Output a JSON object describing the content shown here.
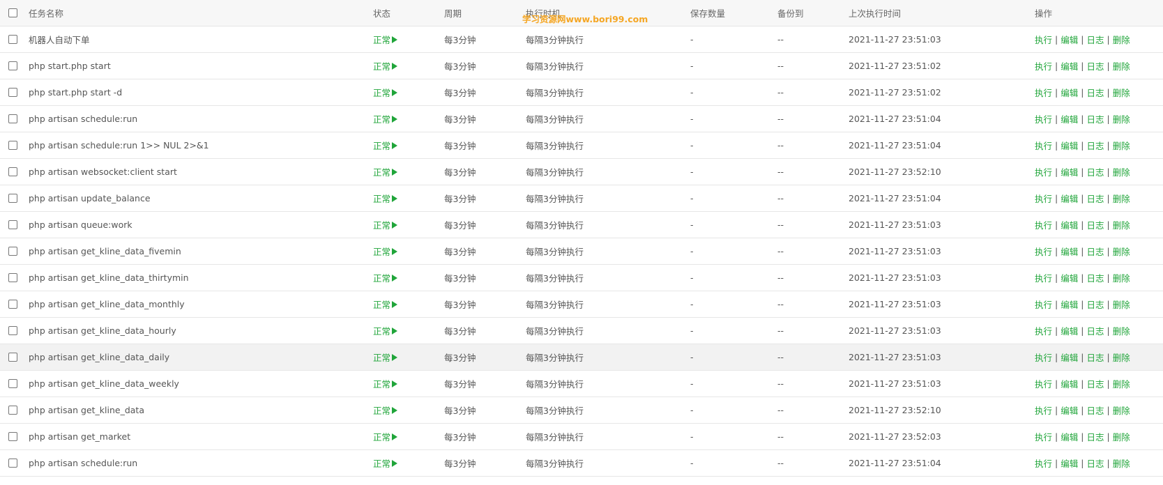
{
  "header": {
    "name": "任务名称",
    "status": "状态",
    "cycle": "周期",
    "exec_time": "执行时机",
    "save_count": "保存数量",
    "backup_to": "备份到",
    "last_run": "上次执行时间",
    "ops": "操作"
  },
  "watermark": "学习资源网www.bori99.com",
  "ops_labels": {
    "run": "执行",
    "edit": "编辑",
    "log": "日志",
    "delete": "删除",
    "sep": "|"
  },
  "colors": {
    "accent": "#20a53a",
    "watermark": "#f5a623"
  },
  "rows": [
    {
      "name": "机器人自动下单",
      "status": "正常",
      "cycle": "每3分钟",
      "exec": "每隔3分钟执行",
      "save": "-",
      "backup": "--",
      "last": "2021-11-27 23:51:03"
    },
    {
      "name": "php start.php start",
      "status": "正常",
      "cycle": "每3分钟",
      "exec": "每隔3分钟执行",
      "save": "-",
      "backup": "--",
      "last": "2021-11-27 23:51:02"
    },
    {
      "name": "php start.php start -d",
      "status": "正常",
      "cycle": "每3分钟",
      "exec": "每隔3分钟执行",
      "save": "-",
      "backup": "--",
      "last": "2021-11-27 23:51:02"
    },
    {
      "name": "php artisan schedule:run",
      "status": "正常",
      "cycle": "每3分钟",
      "exec": "每隔3分钟执行",
      "save": "-",
      "backup": "--",
      "last": "2021-11-27 23:51:04"
    },
    {
      "name": "php artisan schedule:run 1>> NUL 2>&1",
      "status": "正常",
      "cycle": "每3分钟",
      "exec": "每隔3分钟执行",
      "save": "-",
      "backup": "--",
      "last": "2021-11-27 23:51:04"
    },
    {
      "name": "php artisan websocket:client start",
      "status": "正常",
      "cycle": "每3分钟",
      "exec": "每隔3分钟执行",
      "save": "-",
      "backup": "--",
      "last": "2021-11-27 23:52:10"
    },
    {
      "name": "php artisan update_balance",
      "status": "正常",
      "cycle": "每3分钟",
      "exec": "每隔3分钟执行",
      "save": "-",
      "backup": "--",
      "last": "2021-11-27 23:51:04"
    },
    {
      "name": "php artisan queue:work",
      "status": "正常",
      "cycle": "每3分钟",
      "exec": "每隔3分钟执行",
      "save": "-",
      "backup": "--",
      "last": "2021-11-27 23:51:03"
    },
    {
      "name": "php artisan get_kline_data_fivemin",
      "status": "正常",
      "cycle": "每3分钟",
      "exec": "每隔3分钟执行",
      "save": "-",
      "backup": "--",
      "last": "2021-11-27 23:51:03"
    },
    {
      "name": "php artisan get_kline_data_thirtymin",
      "status": "正常",
      "cycle": "每3分钟",
      "exec": "每隔3分钟执行",
      "save": "-",
      "backup": "--",
      "last": "2021-11-27 23:51:03"
    },
    {
      "name": "php artisan get_kline_data_monthly",
      "status": "正常",
      "cycle": "每3分钟",
      "exec": "每隔3分钟执行",
      "save": "-",
      "backup": "--",
      "last": "2021-11-27 23:51:03"
    },
    {
      "name": "php artisan get_kline_data_hourly",
      "status": "正常",
      "cycle": "每3分钟",
      "exec": "每隔3分钟执行",
      "save": "-",
      "backup": "--",
      "last": "2021-11-27 23:51:03"
    },
    {
      "name": "php artisan get_kline_data_daily",
      "status": "正常",
      "cycle": "每3分钟",
      "exec": "每隔3分钟执行",
      "save": "-",
      "backup": "--",
      "last": "2021-11-27 23:51:03"
    },
    {
      "name": "php artisan get_kline_data_weekly",
      "status": "正常",
      "cycle": "每3分钟",
      "exec": "每隔3分钟执行",
      "save": "-",
      "backup": "--",
      "last": "2021-11-27 23:51:03"
    },
    {
      "name": "php artisan get_kline_data",
      "status": "正常",
      "cycle": "每3分钟",
      "exec": "每隔3分钟执行",
      "save": "-",
      "backup": "--",
      "last": "2021-11-27 23:52:10"
    },
    {
      "name": "php artisan get_market",
      "status": "正常",
      "cycle": "每3分钟",
      "exec": "每隔3分钟执行",
      "save": "-",
      "backup": "--",
      "last": "2021-11-27 23:52:03"
    },
    {
      "name": "php artisan schedule:run",
      "status": "正常",
      "cycle": "每3分钟",
      "exec": "每隔3分钟执行",
      "save": "-",
      "backup": "--",
      "last": "2021-11-27 23:51:04"
    }
  ]
}
